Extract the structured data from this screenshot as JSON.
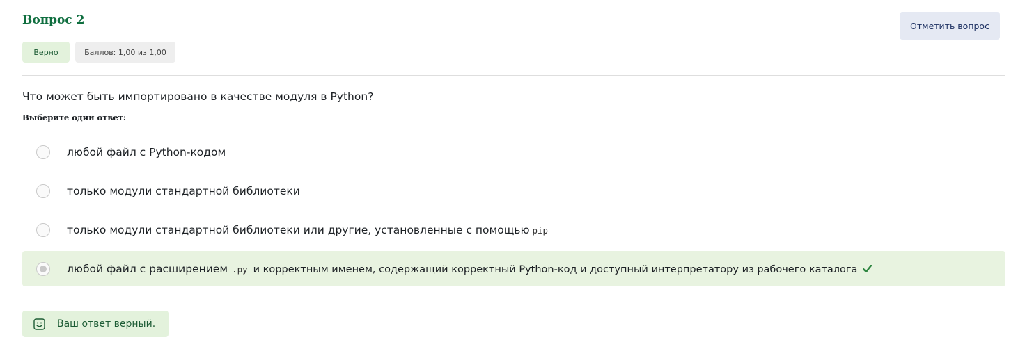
{
  "question": {
    "title": "Вопрос 2",
    "flag_label": "Отметить вопрос",
    "status": "Верно",
    "score": "Баллов: 1,00 из 1,00",
    "text": "Что может быть импортировано в качестве модуля в Python?",
    "prompt": "Выберите один ответ:"
  },
  "answers": [
    {
      "text": "любой файл с Python-кодом",
      "selected": false,
      "correct": false
    },
    {
      "text": "только модули стандартной библиотеки",
      "selected": false,
      "correct": false
    },
    {
      "text": "только модули стандартной библиотеки или другие, установленные с помощью",
      "code": "pip",
      "selected": false,
      "correct": false
    },
    {
      "text_before": "любой файл с расширением",
      "code": ".py",
      "text_after": "и корректным именем, содержащий корректный Python-код и доступный интерпретатору из рабочего каталога",
      "selected": true,
      "correct": true
    }
  ],
  "feedback": {
    "text": "Ваш ответ верный.",
    "icon": "smile-icon"
  },
  "colors": {
    "title": "#0f6e3f",
    "correct_bg": "#e8f3e0",
    "badge_bg": "#e3f2dc",
    "flag_bg": "#e5e9f3",
    "check": "#2e8540"
  }
}
